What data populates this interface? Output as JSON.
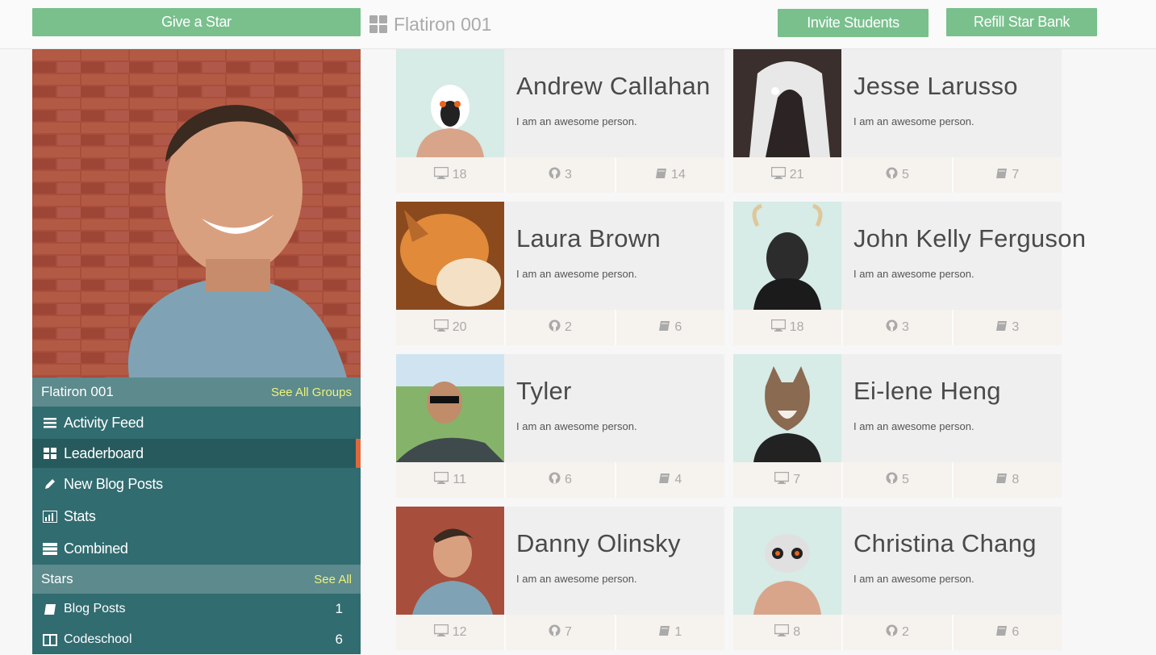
{
  "topbar": {
    "give_star": "Give a Star",
    "group_name": "Flatiron 001",
    "invite_students": "Invite Students",
    "refill_star_bank": "Refill Star Bank"
  },
  "sidebar": {
    "group_header": {
      "title": "Flatiron 001",
      "link": "See All Groups"
    },
    "nav": [
      {
        "label": "Activity Feed",
        "icon": "list-icon"
      },
      {
        "label": "Leaderboard",
        "icon": "grid-icon",
        "active": true
      },
      {
        "label": "New Blog Posts",
        "icon": "pencil-icon"
      },
      {
        "label": "Stats",
        "icon": "bar-chart-icon"
      },
      {
        "label": "Combined",
        "icon": "stack-icon"
      }
    ],
    "stars_header": {
      "title": "Stars",
      "link": "See All"
    },
    "stars": [
      {
        "label": "Blog Posts",
        "count": "1",
        "icon": "book-icon"
      },
      {
        "label": "Codeschool",
        "count": "6",
        "icon": "open-book-icon"
      }
    ]
  },
  "students": [
    {
      "name": "Andrew Callahan",
      "bio": "I am an awesome person.",
      "screens": "18",
      "github": "3",
      "books": "14"
    },
    {
      "name": "Jesse Larusso",
      "bio": "I am an awesome person.",
      "screens": "21",
      "github": "5",
      "books": "7"
    },
    {
      "name": "Laura Brown",
      "bio": "I am an awesome person.",
      "screens": "20",
      "github": "2",
      "books": "6"
    },
    {
      "name": "John Kelly Ferguson",
      "bio": "I am an awesome person.",
      "screens": "18",
      "github": "3",
      "books": "3"
    },
    {
      "name": "Tyler",
      "bio": "I am an awesome person.",
      "screens": "11",
      "github": "6",
      "books": "4"
    },
    {
      "name": "Ei-lene Heng",
      "bio": "I am an awesome person.",
      "screens": "7",
      "github": "5",
      "books": "8"
    },
    {
      "name": "Danny Olinsky",
      "bio": "I am an awesome person.",
      "screens": "12",
      "github": "7",
      "books": "1"
    },
    {
      "name": "Christina Chang",
      "bio": "I am an awesome person.",
      "screens": "8",
      "github": "2",
      "books": "6"
    }
  ],
  "colors": {
    "accent_green": "#79c08d",
    "sidebar_teal": "#316c70",
    "sidebar_header": "#5c8a8d",
    "active_marker": "#e0673b",
    "link_yellow": "#eef27a"
  }
}
